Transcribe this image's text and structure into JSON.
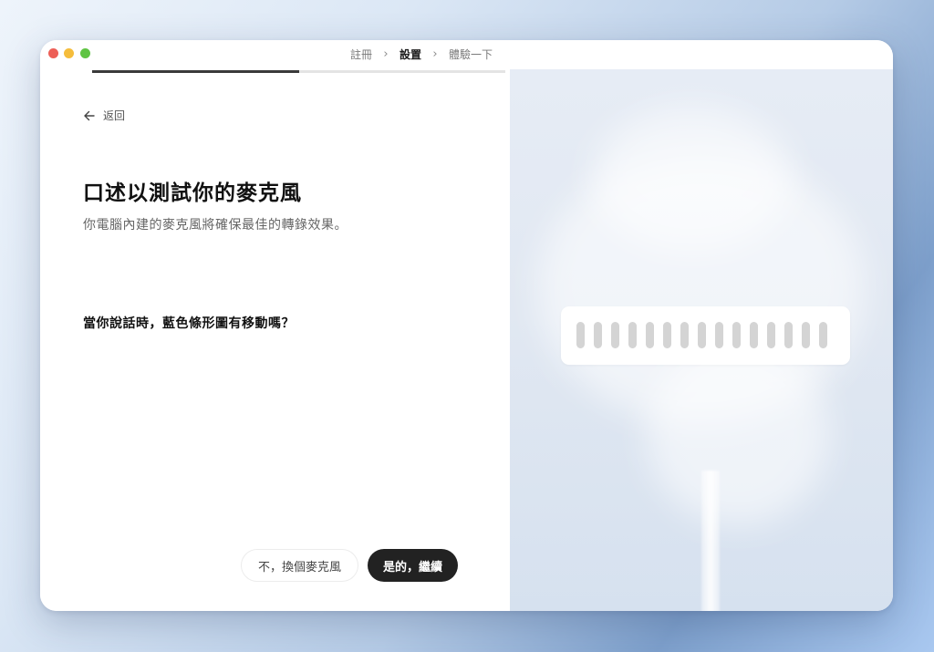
{
  "stepper": {
    "steps": [
      {
        "label": "註冊",
        "active": false
      },
      {
        "label": "設置",
        "active": true
      },
      {
        "label": "體驗一下",
        "active": false
      }
    ],
    "progress": 0.5
  },
  "back": {
    "label": "返回",
    "icon": "arrow-left-icon"
  },
  "content": {
    "title": "口述以測試你的麥克風",
    "subtitle": "你電腦內建的麥克風將確保最佳的轉錄效果。",
    "question": "當你說話時，藍色條形圖有移動嗎？"
  },
  "actions": {
    "secondary_label": "不，換個麥克風",
    "primary_label": "是的，繼續"
  },
  "mic_meter": {
    "bar_count": 15,
    "bar_color": "#d4d4d4"
  },
  "colors": {
    "primary_button": "#222222",
    "traffic_red": "#ed5f57",
    "traffic_yellow": "#f5bd3c",
    "traffic_green": "#5fc443"
  }
}
